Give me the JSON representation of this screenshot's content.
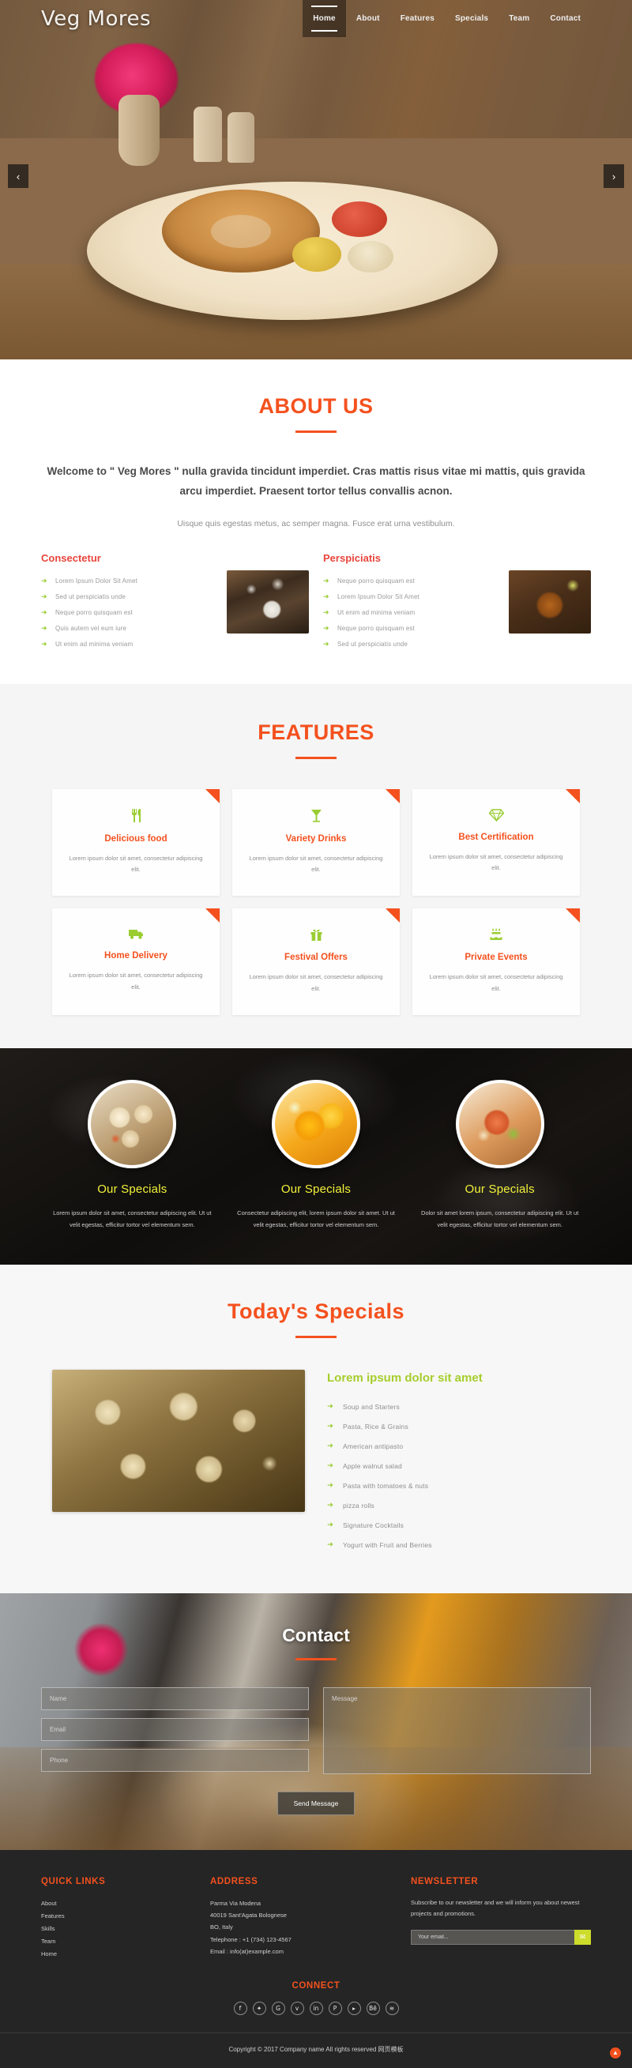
{
  "header": {
    "logo": "Veg Mores",
    "nav": [
      {
        "label": "Home",
        "active": true
      },
      {
        "label": "About",
        "active": false
      },
      {
        "label": "Features",
        "active": false
      },
      {
        "label": "Specials",
        "active": false
      },
      {
        "label": "Team",
        "active": false
      },
      {
        "label": "Contact",
        "active": false
      }
    ],
    "prev_icon": "chevron-left-icon",
    "next_icon": "chevron-right-icon"
  },
  "about": {
    "title": "ABOUT US",
    "lead": "Welcome to \" Veg Mores \" nulla gravida tincidunt imperdiet. Cras mattis risus vitae mi mattis, quis gravida arcu imperdiet. Praesent tortor tellus convallis acnon.",
    "sub": "Uisque quis egestas metus, ac semper magna. Fusce erat urna vestibulum.",
    "columns": [
      {
        "heading": "Consectetur",
        "items": [
          "Lorem Ipsum Dolor Sit Amet",
          "Sed ut perspiciatis unde",
          "Neque porro quisquam est",
          "Quis autem vel eum iure",
          "Ut enim ad minima veniam"
        ]
      },
      {
        "heading": "Perspiciatis",
        "items": [
          "Neque porro quisquam est",
          "Lorem Ipsum Dolor Sit Amet",
          "Ut enim ad minima veniam",
          "Neque porro quisquam est",
          "Sed ut perspiciatis unde"
        ]
      }
    ]
  },
  "features": {
    "title": "FEATURES",
    "cards": [
      {
        "icon": "cutlery-icon",
        "title": "Delicious food",
        "desc": "Lorem ipsum dolor sit amet, consectetur adipiscing elit."
      },
      {
        "icon": "cocktail-glass-icon",
        "title": "Variety Drinks",
        "desc": "Lorem ipsum dolor sit amet, consectetur adipiscing elit."
      },
      {
        "icon": "diamond-icon",
        "title": "Best Certification",
        "desc": "Lorem ipsum dolor sit amet, consectetur adipiscing elit."
      },
      {
        "icon": "delivery-truck-icon",
        "title": "Home Delivery",
        "desc": "Lorem ipsum dolor sit amet, consectetur adipiscing elit."
      },
      {
        "icon": "gift-icon",
        "title": "Festival Offers",
        "desc": "Lorem ipsum dolor sit amet, consectetur adipiscing elit."
      },
      {
        "icon": "birthday-cake-icon",
        "title": "Private Events",
        "desc": "Lorem ipsum dolor sit amet, consectetur adipiscing elit."
      }
    ]
  },
  "specials": {
    "items": [
      {
        "title": "Our Specials",
        "desc": "Lorem ipsum dolor sit amet, consectetur adipiscing elit. Ut ut velit egestas, efficitur tortor vel elementum sem."
      },
      {
        "title": "Our Specials",
        "desc": "Consectetur adipiscing elit, lorem ipsum dolor sit amet. Ut ut velit egestas, efficitur tortor vel elementum sem."
      },
      {
        "title": "Our Specials",
        "desc": "Dolor sit amet lorem ipsum, consectetur adipiscing elit. Ut ut velit egestas, efficitur tortor vel elementum sem."
      }
    ]
  },
  "today": {
    "title": "Today's Specials",
    "menu_heading": "Lorem ipsum dolor sit amet",
    "menu_items": [
      "Soup and Starters",
      "Pasta, Rice & Grains",
      "American antipasto",
      "Apple walnut salad",
      "Pasta with tomatoes & nuts",
      "pizza rolls",
      "Signature Cocktails",
      "Yogurt with Fruit and Berries"
    ]
  },
  "contact": {
    "title": "Contact",
    "name_placeholder": "Name",
    "email_placeholder": "Email",
    "phone_placeholder": "Phone",
    "message_placeholder": "Message",
    "submit_label": "Send Message"
  },
  "footer": {
    "quick_links": {
      "heading": "QUICK LINKS",
      "items": [
        "About",
        "Features",
        "Skills",
        "Team",
        "Home"
      ]
    },
    "address": {
      "heading": "ADDRESS",
      "line1": "Parma Via Modena",
      "line2": "40019 Sant'Agata Bolognese",
      "line3": "BO, Italy",
      "telephone": "Telephone : +1 (734) 123-4567",
      "email": "Email : info(at)example.com"
    },
    "newsletter": {
      "heading": "NEWSLETTER",
      "text": "Subscribe to our newsletter and we will inform you about newest projects and promotions.",
      "input_placeholder": "Your email...",
      "button_icon": "envelope-icon"
    },
    "connect": {
      "heading": "CONNECT",
      "socials": [
        {
          "name": "facebook-icon",
          "glyph": "f"
        },
        {
          "name": "twitter-icon",
          "glyph": "✦"
        },
        {
          "name": "google-plus-icon",
          "glyph": "G"
        },
        {
          "name": "vimeo-icon",
          "glyph": "v"
        },
        {
          "name": "linkedin-icon",
          "glyph": "in"
        },
        {
          "name": "pinterest-icon",
          "glyph": "P"
        },
        {
          "name": "youtube-icon",
          "glyph": "▸"
        },
        {
          "name": "behance-icon",
          "glyph": "Bē"
        },
        {
          "name": "rss-icon",
          "glyph": "≋"
        }
      ]
    },
    "copyright": "Copyright © 2017 Company name All rights reserved 网页模板",
    "to_top_icon": "arrow-up-icon"
  },
  "colors": {
    "accent_orange": "#f4511e",
    "accent_red": "#e8453c",
    "accent_green": "#9acd32",
    "accent_yellow": "#f2f23a",
    "footer_bg": "#252525"
  }
}
